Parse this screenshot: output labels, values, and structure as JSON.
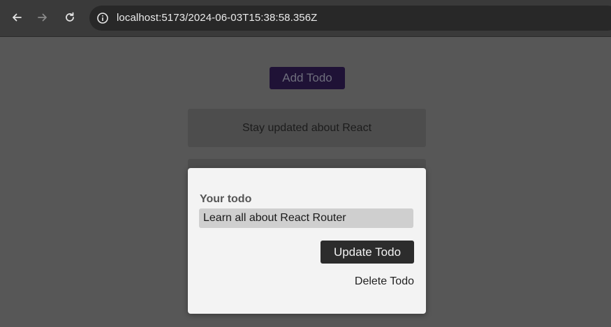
{
  "browser": {
    "icons": {
      "back": "arrow-left-icon",
      "forward": "arrow-right-icon",
      "reload": "reload-icon",
      "site_info": "info-icon"
    },
    "url": "localhost:5173/2024-06-03T15:38:58.356Z"
  },
  "page": {
    "add_todo_label": "Add Todo",
    "todos": [
      {
        "text": "Stay updated about React"
      },
      {
        "text": ""
      }
    ]
  },
  "modal": {
    "label": "Your todo",
    "input_value": "Learn all about React Router",
    "update_label": "Update Todo",
    "delete_label": "Delete Todo"
  },
  "colors": {
    "backdrop": "#575757",
    "modal_bg": "#f3f3f3",
    "primary_button": "#2c2c2c",
    "add_todo_bg": "#1f1236"
  }
}
